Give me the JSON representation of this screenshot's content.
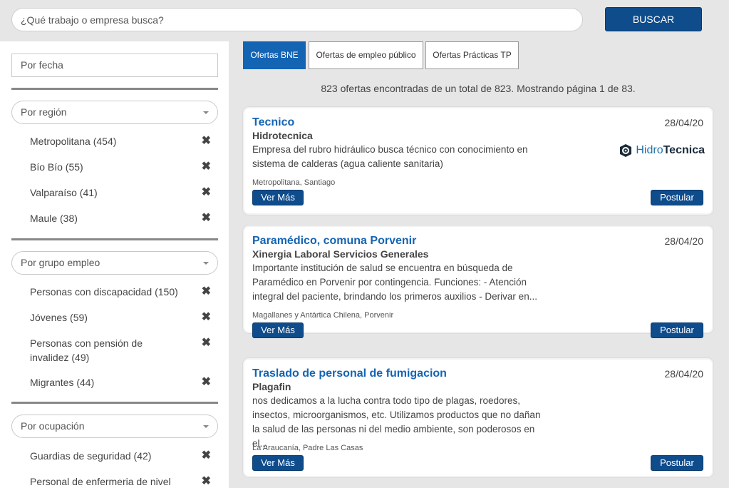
{
  "search": {
    "placeholder": "¿Qué trabajo o empresa busca?",
    "button_label": "BUSCAR"
  },
  "sidebar": {
    "date_filter": "Por fecha",
    "groups": [
      {
        "label": "Por región",
        "items": [
          {
            "label": "Metropolitana (454)"
          },
          {
            "label": "Bío Bío (55)"
          },
          {
            "label": "Valparaíso (41)"
          },
          {
            "label": "Maule (38)"
          }
        ]
      },
      {
        "label": "Por grupo empleo",
        "items": [
          {
            "label": "Personas con discapacidad (150)"
          },
          {
            "label": "Jóvenes (59)"
          },
          {
            "label": "Personas con pensión de invalidez (49)"
          },
          {
            "label": "Migrantes (44)"
          }
        ]
      },
      {
        "label": "Por ocupación",
        "items": [
          {
            "label": "Guardias de seguridad (42)"
          },
          {
            "label": "Personal de enfermeria de nivel"
          }
        ]
      }
    ]
  },
  "tabs": [
    {
      "label": "Ofertas BNE",
      "active": true
    },
    {
      "label": "Ofertas de empleo público",
      "active": false
    },
    {
      "label": "Ofertas Prácticas TP",
      "active": false
    }
  ],
  "summary": "823 ofertas encontradas de un total de 823. Mostrando página 1 de 83.",
  "jobs": [
    {
      "title": "Tecnico",
      "company": "Hidrotecnica",
      "date": "28/04/20",
      "description": "Empresa del rubro hidráulico busca técnico con conocimiento en sistema de calderas (agua caliente sanitaria)",
      "location": "Metropolitana, Santiago",
      "logo": {
        "text_light": "Hidro",
        "text_bold": "Tecnica"
      },
      "more_label": "Ver Más",
      "apply_label": "Postular"
    },
    {
      "title": "Paramédico, comuna Porvenir",
      "company": "Xinergia Laboral Servicios Generales",
      "date": "28/04/20",
      "description": "Importante institución de salud se encuentra en búsqueda de Paramédico en Porvenir por contingencia. Funciones: - Atención integral del paciente, brindando los primeros auxilios - Derivar en...",
      "location": "Magallanes y Antártica Chilena, Porvenir",
      "more_label": "Ver Más",
      "apply_label": "Postular"
    },
    {
      "title": "Traslado de personal de fumigacion",
      "company": "Plagafin",
      "date": "28/04/20",
      "description": "nos dedicamos a la lucha contra todo tipo de plagas, roedores, insectos, microorganismos, etc. Utilizamos productos que no dañan la salud de las personas ni del medio ambiente, son poderosos en el...",
      "location": "La Araucanía, Padre Las Casas",
      "more_label": "Ver Más",
      "apply_label": "Postular"
    }
  ],
  "colors": {
    "primary": "#0f4c8c",
    "link": "#1464b4",
    "background": "#e6e6e6"
  }
}
